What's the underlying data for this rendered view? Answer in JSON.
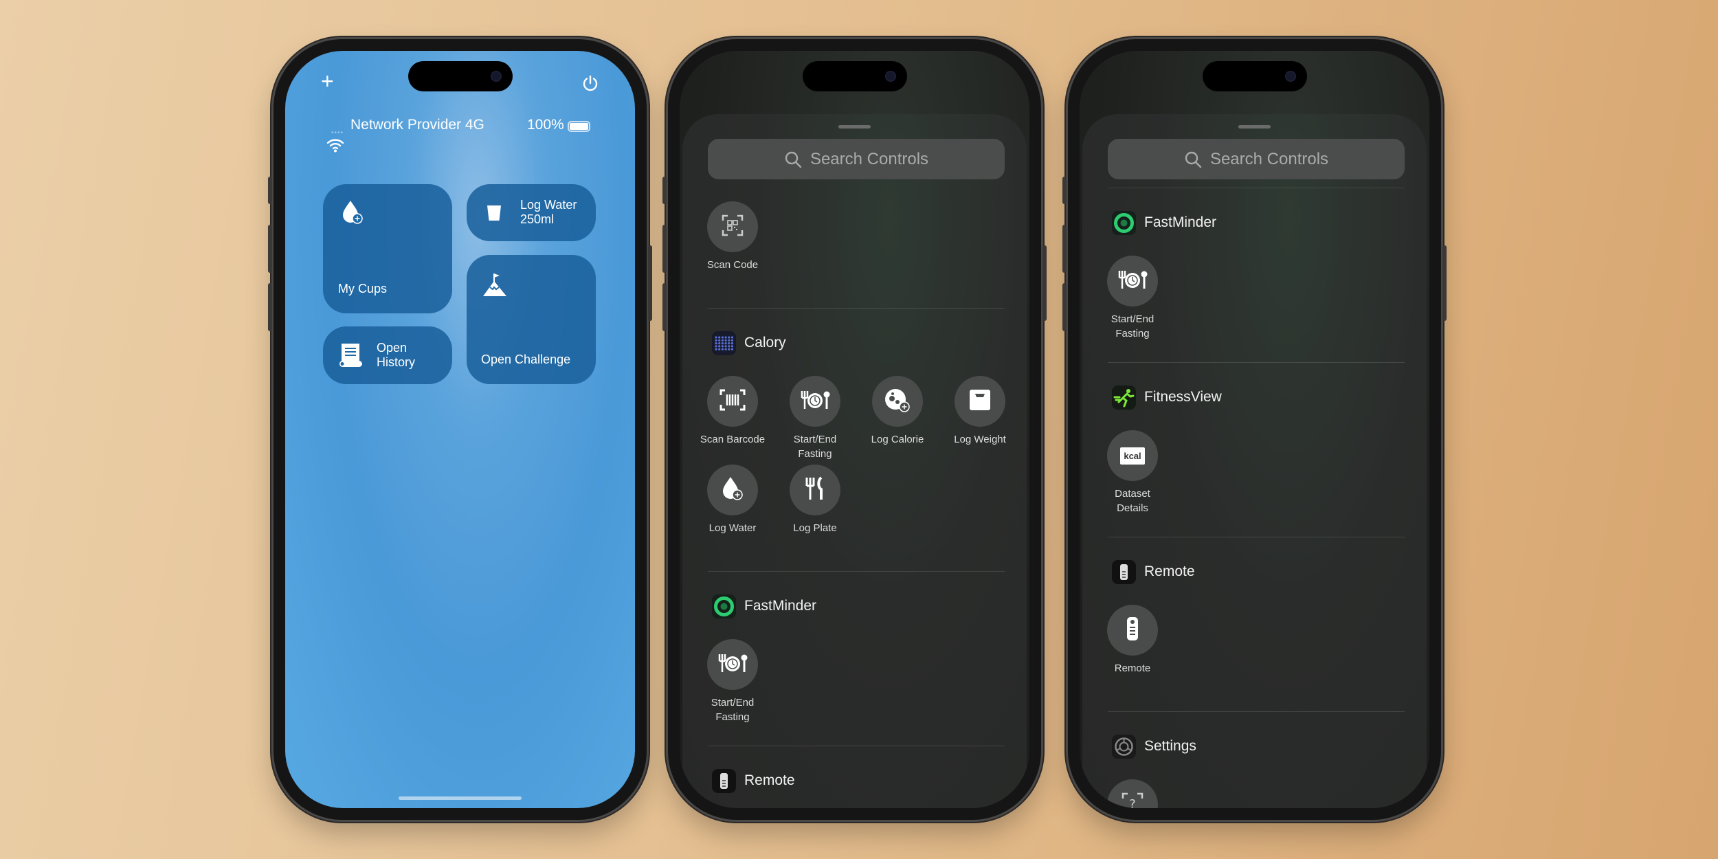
{
  "phone1": {
    "status": {
      "carrier": "Network Provider 4G",
      "battery": "100%",
      "battery_level": 1.0
    },
    "top_icons": [
      "plus-icon",
      "power-icon"
    ],
    "tiles": [
      {
        "label": "My Cups",
        "icon": "water-drop-plus-icon"
      },
      {
        "label": "Log Water\n250ml",
        "icon": "cup-icon"
      },
      {
        "label": "Open Challenge",
        "icon": "mountain-flag-icon"
      },
      {
        "label": "Open\nHistory",
        "icon": "receipt-scroll-icon"
      }
    ]
  },
  "phone2": {
    "search_placeholder": "Search Controls",
    "sections": [
      {
        "app": "",
        "controls": [
          {
            "label": "Scan Code",
            "icon": "qr-scan-icon"
          }
        ]
      },
      {
        "app": "Calory",
        "app_icon": "calory-app-icon",
        "controls": [
          {
            "label": "Scan Barcode",
            "icon": "barcode-scan-icon"
          },
          {
            "label": "Start/End\nFasting",
            "icon": "fasting-plate-clock-icon"
          },
          {
            "label": "Log Calorie",
            "icon": "calorie-plus-icon"
          },
          {
            "label": "Log Weight",
            "icon": "scale-icon"
          },
          {
            "label": "Log Water",
            "icon": "water-drop-plus-icon"
          },
          {
            "label": "Log Plate",
            "icon": "fork-knife-icon"
          }
        ]
      },
      {
        "app": "FastMinder",
        "app_icon": "fastminder-app-icon",
        "controls": [
          {
            "label": "Start/End\nFasting",
            "icon": "fasting-plate-clock-icon"
          }
        ]
      },
      {
        "app": "Remote",
        "app_icon": "remote-app-icon",
        "controls": []
      }
    ]
  },
  "phone3": {
    "search_placeholder": "Search Controls",
    "sections": [
      {
        "app": "FastMinder",
        "app_icon": "fastminder-app-icon",
        "controls": [
          {
            "label": "Start/End\nFasting",
            "icon": "fasting-plate-clock-icon"
          }
        ]
      },
      {
        "app": "FitnessView",
        "app_icon": "fitnessview-app-icon",
        "controls": [
          {
            "label": "Dataset\nDetails",
            "icon": "kcal-icon",
            "icon_text": "kcal"
          }
        ]
      },
      {
        "app": "Remote",
        "app_icon": "remote-app-icon",
        "controls": [
          {
            "label": "Remote",
            "icon": "remote-icon"
          }
        ]
      },
      {
        "app": "Settings",
        "app_icon": "settings-app-icon",
        "controls": [
          {
            "label": "",
            "icon": "question-scan-icon"
          }
        ]
      }
    ]
  },
  "colors": {
    "background": "#e3bd8e",
    "phone1_screen": "#4a99d8",
    "tile": "#1d69a6",
    "sheet": "#2a2c2b",
    "control_circle": "#4a4b4b"
  }
}
